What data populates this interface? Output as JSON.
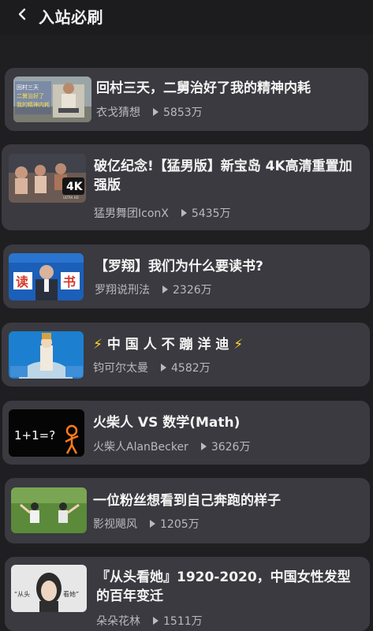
{
  "header": {
    "title": "入站必刷",
    "back_icon": "chevron-left-icon"
  },
  "videos": [
    {
      "title": "回村三天，二舅治好了我的精神内耗",
      "author": "衣戈猜想",
      "views": "5853万",
      "thumb_text": [
        "回村三天",
        "二舅治好了",
        "我的精神内耗"
      ]
    },
    {
      "title": "破亿纪念!【猛男版】新宝岛 4K高清重置加强版",
      "author": "猛男舞团IconX",
      "views": "5435万",
      "thumb_badge": "4K",
      "thumb_badge_sub": "ULTRA HD"
    },
    {
      "title": "【罗翔】我们为什么要读书?",
      "author": "罗翔说刑法",
      "views": "2326万",
      "thumb_text": [
        "读",
        "书"
      ]
    },
    {
      "title_prefix_icon": "lightning-icon",
      "title": "中 国 人 不 蹦 洋 迪",
      "title_suffix_icon": "lightning-icon",
      "author": "钧可尔太曼",
      "views": "4582万"
    },
    {
      "title": "火柴人 VS 数学(Math)",
      "author": "火柴人AlanBecker",
      "views": "3626万",
      "thumb_text": "1+1=?"
    },
    {
      "title": "一位粉丝想看到自己奔跑的样子",
      "author": "影视飓风",
      "views": "1205万"
    },
    {
      "title": "『从头看她』1920-2020，中国女性发型的百年变迁",
      "author": "朵朵花林",
      "views": "1511万",
      "thumb_text": [
        "“从头",
        "看她”"
      ]
    }
  ],
  "colors": {
    "background": "#1f1f22",
    "card": "#3a3a40",
    "title_text": "#f4f4f4",
    "meta_text": "#b9b9c0",
    "lightning": "#ffd22e"
  }
}
